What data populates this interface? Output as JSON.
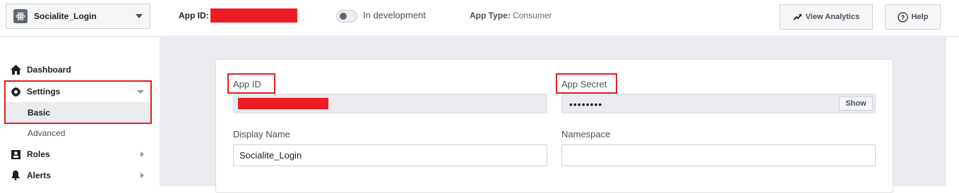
{
  "topbar": {
    "app_name": "Socialite_Login",
    "app_id_label": "App ID:",
    "dev_mode_label": "In development",
    "app_type_label": "App Type:",
    "app_type_value": "Consumer",
    "analytics_button": "View Analytics",
    "help_button": "Help"
  },
  "sidebar": {
    "items": [
      {
        "label": "Dashboard",
        "icon": "house-icon"
      },
      {
        "label": "Settings",
        "icon": "gear-icon"
      },
      {
        "label": "Basic"
      },
      {
        "label": "Advanced"
      },
      {
        "label": "Roles",
        "icon": "roles-icon"
      },
      {
        "label": "Alerts",
        "icon": "bell-icon"
      }
    ]
  },
  "form": {
    "app_id_label": "App ID",
    "app_secret_label": "App Secret",
    "app_secret_masked": "••••••••",
    "show_button": "Show",
    "display_name_label": "Display Name",
    "display_name_value": "Socialite_Login",
    "namespace_label": "Namespace",
    "namespace_value": ""
  },
  "colors": {
    "redaction": "#ed1c24",
    "highlight_border": "#e02020",
    "main_bg": "#e9ebee"
  }
}
